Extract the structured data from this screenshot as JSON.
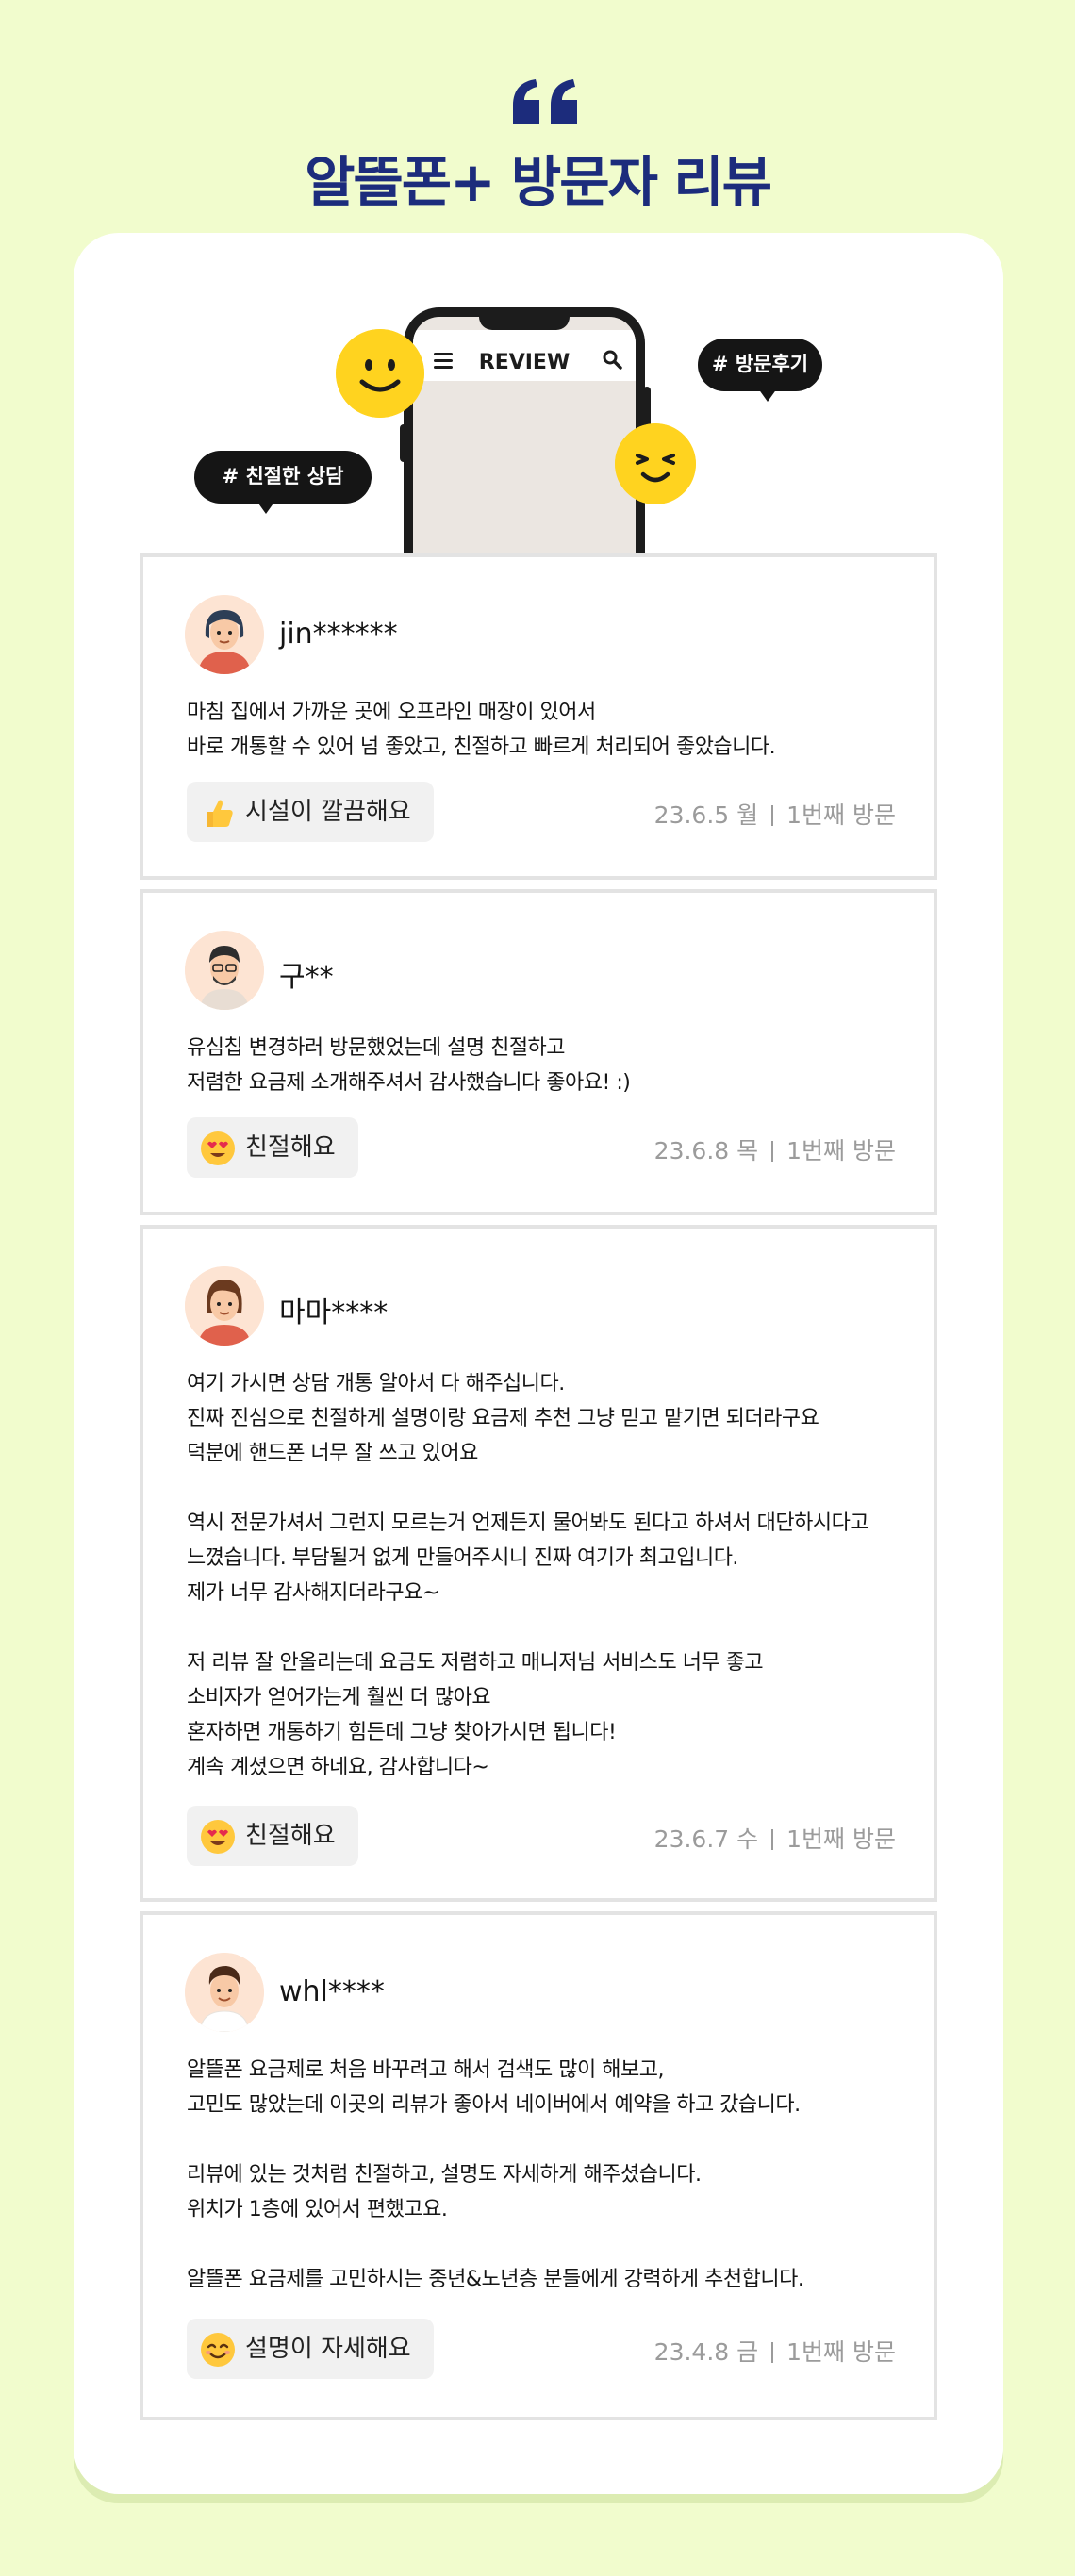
{
  "page": {
    "title": "알뜰폰+ 방문자 리뷰"
  },
  "colors": {
    "background": "#f1fccd",
    "title": "#1c2c7c",
    "smiley": "#ffd31f",
    "bubble": "#151515",
    "meta_text": "#9b9b9b"
  },
  "illustration": {
    "phone_title": "REVIEW",
    "bubble_left": "# 친절한 상담",
    "bubble_right": "# 방문후기",
    "icons": [
      "quote-icon",
      "menu-icon",
      "search-icon",
      "smiley-icon",
      "wink-smiley-icon"
    ]
  },
  "reviews": [
    {
      "username": "jin******",
      "text": "마침 집에서 가까운 곳에 오프라인 매장이 있어서\n바로 개통할 수 있어 넘 좋았고, 친절하고 빠르게 처리되어 좋았습니다.",
      "tag": "시설이 깔끔해요",
      "tag_icon": "thumbs-up-icon",
      "date": "23.6.5 월",
      "visit": "1번째 방문"
    },
    {
      "username": "구**",
      "text": "유심칩 변경하러 방문했었는데 설명 친절하고\n저렴한 요금제 소개해주셔서 감사했습니다 좋아요! :)",
      "tag": "친절해요",
      "tag_icon": "heart-eyes-icon",
      "date": "23.6.8 목",
      "visit": "1번째 방문"
    },
    {
      "username": "마마****",
      "text": "여기 가시면 상담 개통 알아서 다 해주십니다.\n진짜 진심으로 친절하게 설명이랑 요금제 추천 그냥 믿고 맡기면 되더라구요\n덕분에 핸드폰 너무 잘 쓰고 있어요\n\n역시 전문가셔서 그런지 모르는거 언제든지 물어봐도 된다고 하셔서 대단하시다고\n느꼈습니다. 부담될거 없게 만들어주시니 진짜 여기가 최고입니다.\n제가 너무 감사해지더라구요~\n\n저 리뷰 잘 안올리는데 요금도 저렴하고 매니저님 서비스도 너무 좋고\n소비자가 얻어가는게 훨씬 더 많아요\n혼자하면 개통하기 힘든데 그냥 찾아가시면 됩니다!\n계속 계셨으면 하네요, 감사합니다~",
      "tag": "친절해요",
      "tag_icon": "heart-eyes-icon",
      "date": "23.6.7 수",
      "visit": "1번째 방문"
    },
    {
      "username": "whl****",
      "text": "알뜰폰 요금제로 처음 바꾸려고 해서 검색도 많이 해보고,\n고민도 많았는데 이곳의 리뷰가 좋아서 네이버에서 예약을 하고 갔습니다.\n\n리뷰에 있는 것처럼 친절하고, 설명도 자세하게 해주셨습니다.\n위치가 1층에 있어서 편했고요.\n\n알뜰폰 요금제를 고민하시는 중년&노년층 분들에게 강력하게 추천합니다.",
      "tag": "설명이 자세해요",
      "tag_icon": "smiling-face-icon",
      "date": "23.4.8 금",
      "visit": "1번째 방문"
    }
  ]
}
